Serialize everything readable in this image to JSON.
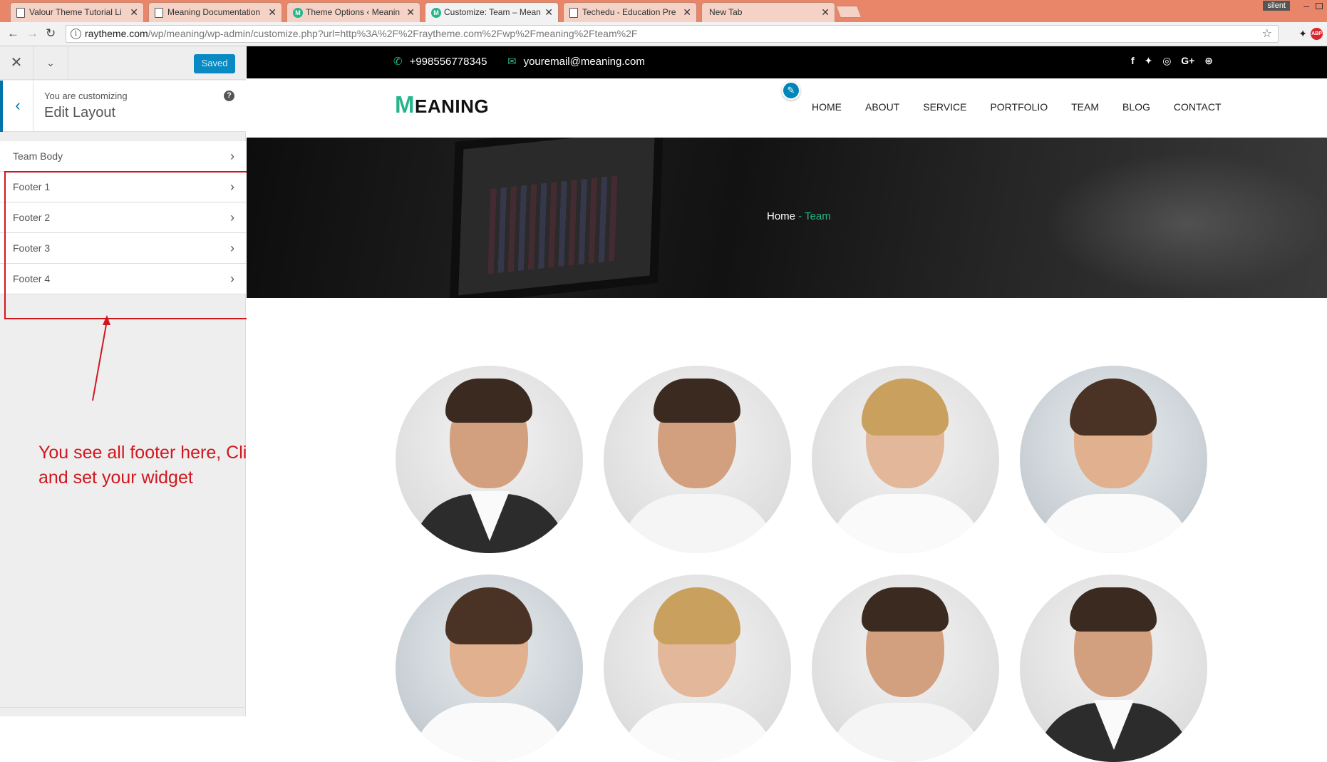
{
  "browser": {
    "tabs": [
      {
        "label": "Valour Theme Tutorial Li",
        "icon": "page-icon"
      },
      {
        "label": "Meaning Documentation",
        "icon": "page-icon"
      },
      {
        "label": "Theme Options ‹ Meanin",
        "icon": "meaning-favicon"
      },
      {
        "label": "Customize: Team – Mean",
        "icon": "meaning-favicon"
      },
      {
        "label": "Techedu - Education Pre",
        "icon": "page-icon"
      },
      {
        "label": "New Tab",
        "icon": ""
      }
    ],
    "profile_label": "silent",
    "url_host": "raytheme.com",
    "url_path": "/wp/meaning/wp-admin/customize.php?url=http%3A%2F%2Fraytheme.com%2Fwp%2Fmeaning%2Fteam%2F",
    "ext_label": "ABP"
  },
  "customizer": {
    "saved_label": "Saved",
    "customizing_label": "You are customizing",
    "section_title": "Edit Layout",
    "items": [
      {
        "label": "Team Body"
      },
      {
        "label": "Footer 1"
      },
      {
        "label": "Footer 2"
      },
      {
        "label": "Footer 3"
      },
      {
        "label": "Footer 4"
      }
    ]
  },
  "annotation": {
    "text_line1": "You see all footer here, Click on the footer",
    "text_line2": "and set your widget",
    "color": "#d0171f"
  },
  "site": {
    "accent_color": "#26b58a",
    "phone": "+998556778345",
    "email": "youremail@meaning.com",
    "social_icons": [
      "facebook-icon",
      "twitter-icon",
      "instagram-icon",
      "google-plus-icon",
      "dribbble-icon"
    ],
    "logo_first": "M",
    "logo_rest": "EANING",
    "menu": [
      "HOME",
      "ABOUT",
      "SERVICE",
      "PORTFOLIO",
      "TEAM",
      "BLOG",
      "CONTACT"
    ],
    "breadcrumb": {
      "home": "Home",
      "sep": " - ",
      "current": "Team"
    }
  }
}
